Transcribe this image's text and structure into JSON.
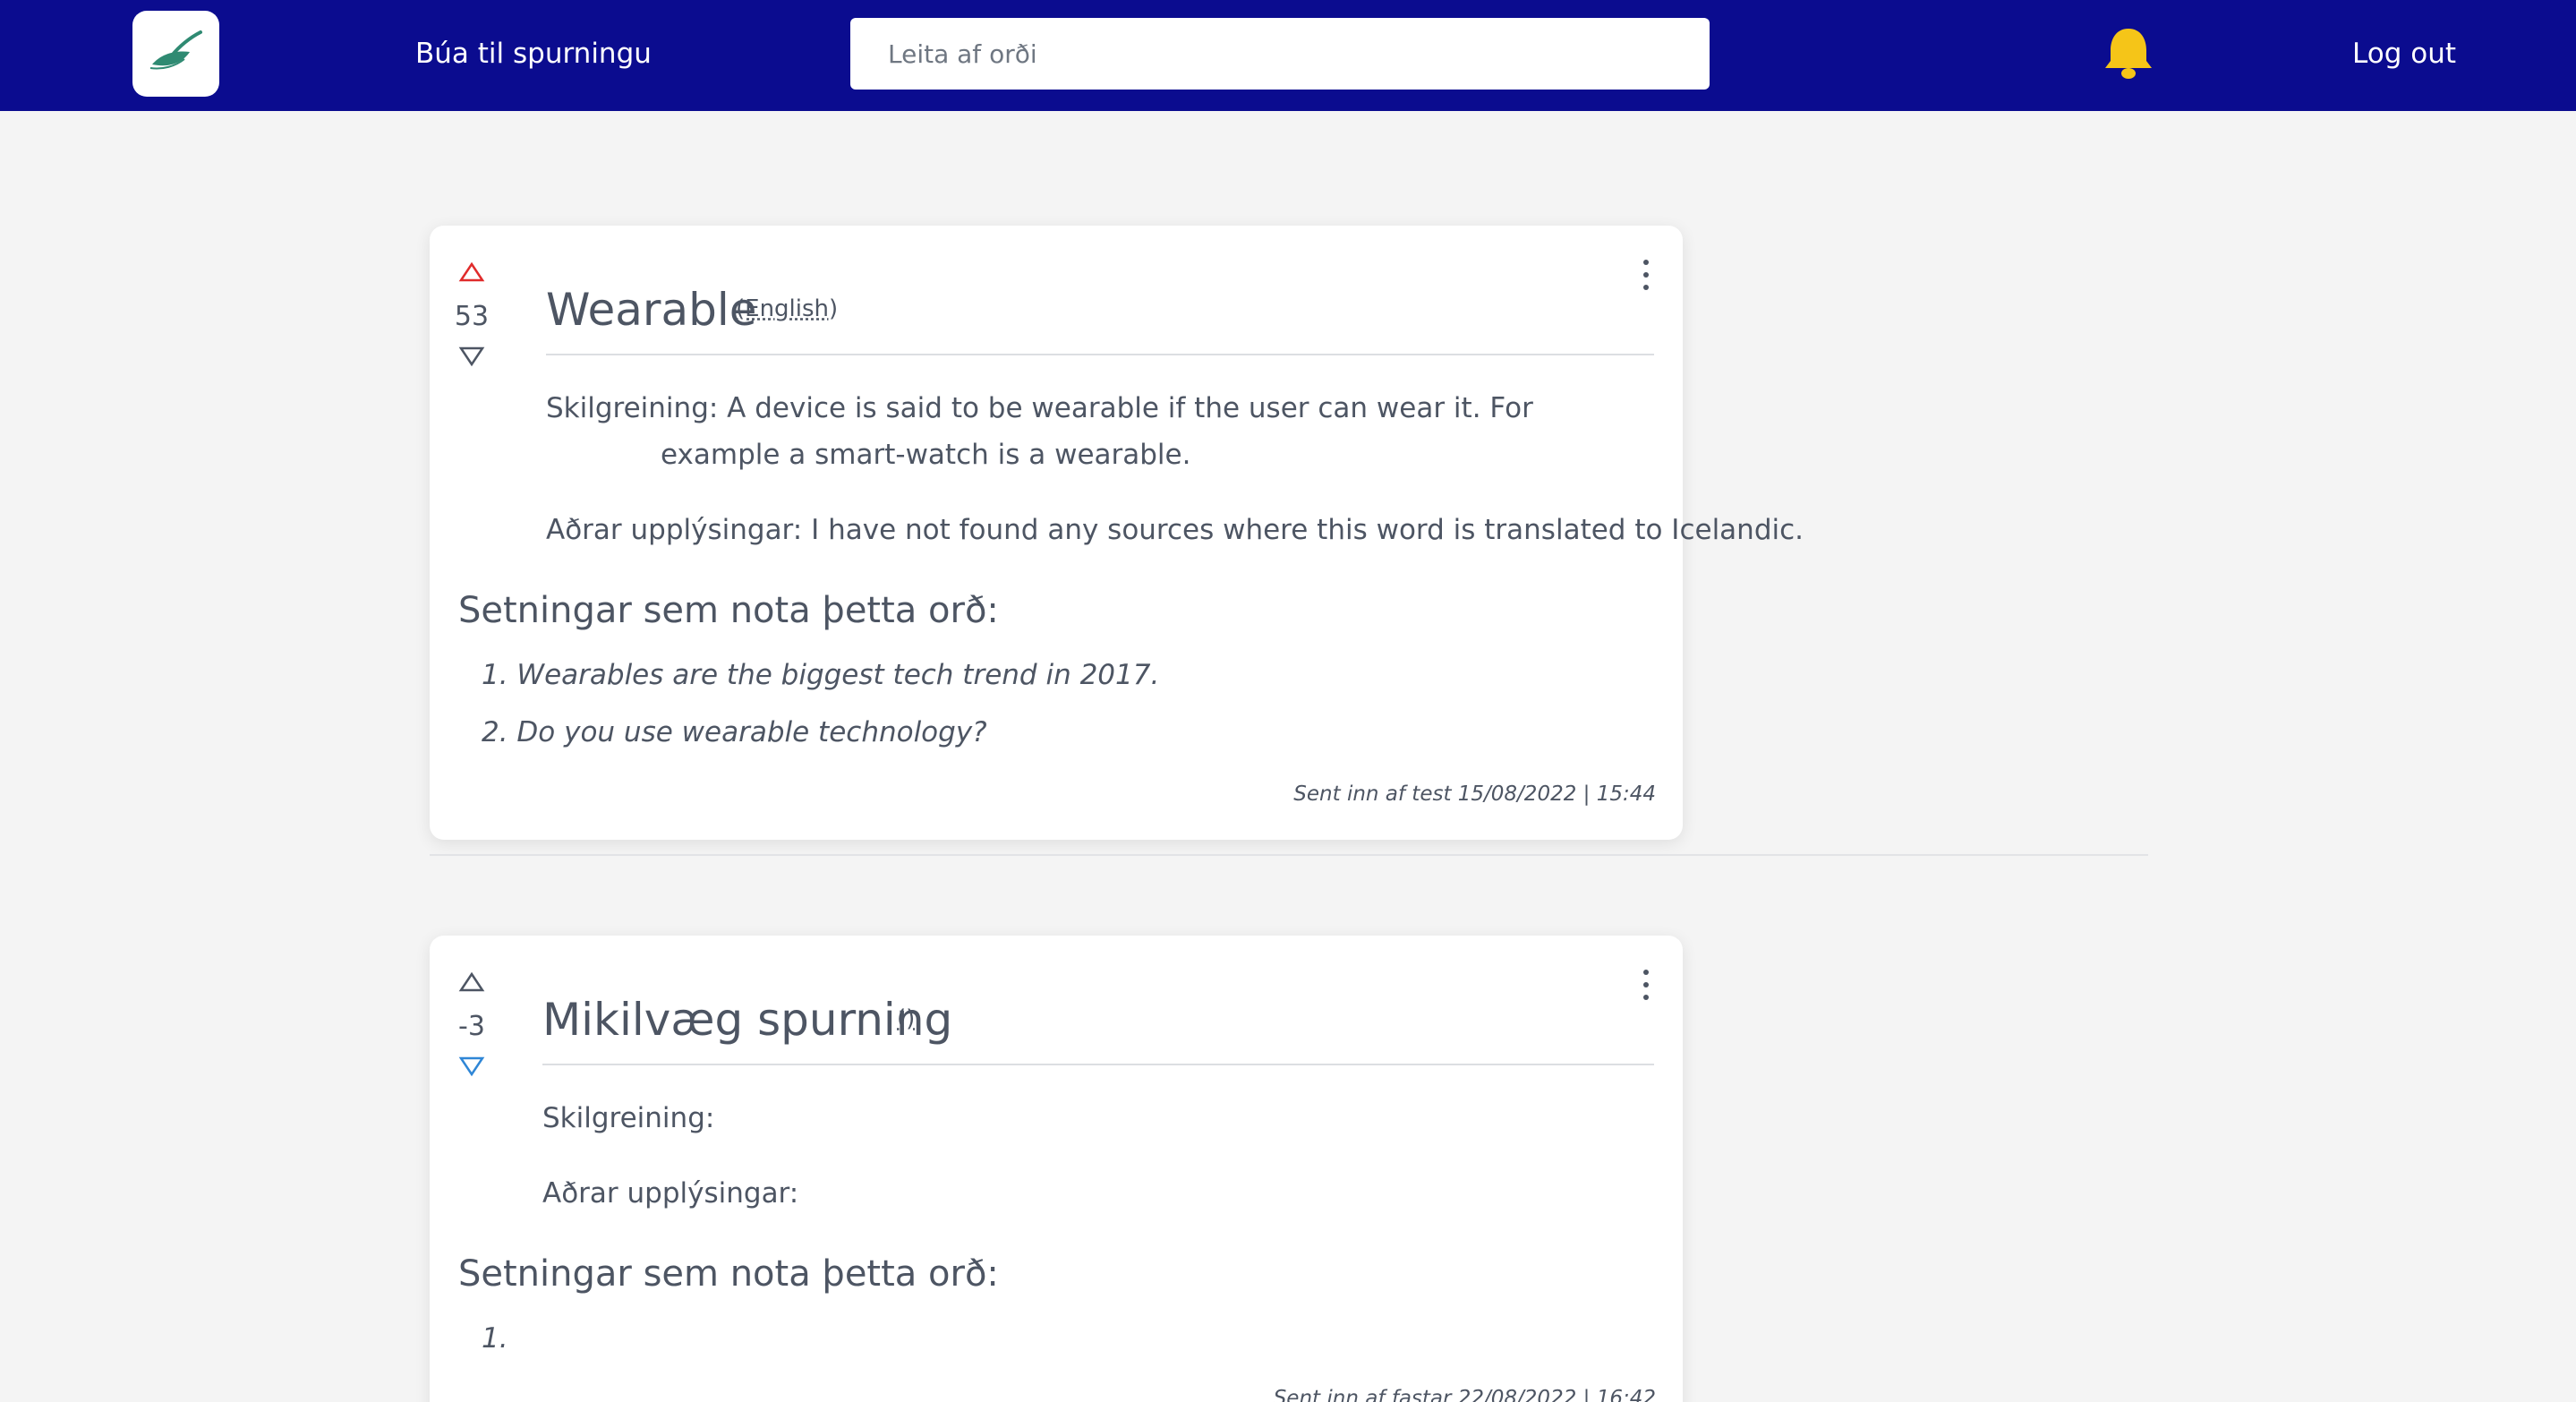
{
  "header": {
    "create_label": "Búa til spurningu",
    "search_placeholder": "Leita af orði",
    "logout_label": "Log out"
  },
  "colors": {
    "navbar": "#0b0c8f",
    "bell": "#f5c518",
    "upvote_active": "#e02b2b",
    "downvote_active": "#2f86d6"
  },
  "posts": [
    {
      "score": "53",
      "vote_state": "upvoted",
      "term": "Wearable",
      "language": "(English)",
      "definition_label": "Skilgreining:",
      "definition": "A device is said to be wearable if the user can wear it. For example a smart-watch is a wearable.",
      "other_info_label": "Aðrar upplýsingar:",
      "other_info": "I have not found any sources where this word is translated to Icelandic.",
      "sentences_heading": "Setningar sem nota þetta orð:",
      "sentences": [
        "1. Wearables are the biggest tech trend in 2017.",
        "2. Do you use wearable technology?"
      ],
      "submitted": "Sent inn af test 15/08/2022 | 15:44"
    },
    {
      "score": "-3",
      "vote_state": "downvoted",
      "term": "Mikilvæg spurning",
      "language": "()",
      "definition_label": "Skilgreining:",
      "definition": "",
      "other_info_label": "Aðrar upplýsingar:",
      "other_info": "",
      "sentences_heading": "Setningar sem nota þetta orð:",
      "sentences": [
        "1."
      ],
      "submitted": "Sent inn af fastar 22/08/2022 | 16:42"
    }
  ]
}
